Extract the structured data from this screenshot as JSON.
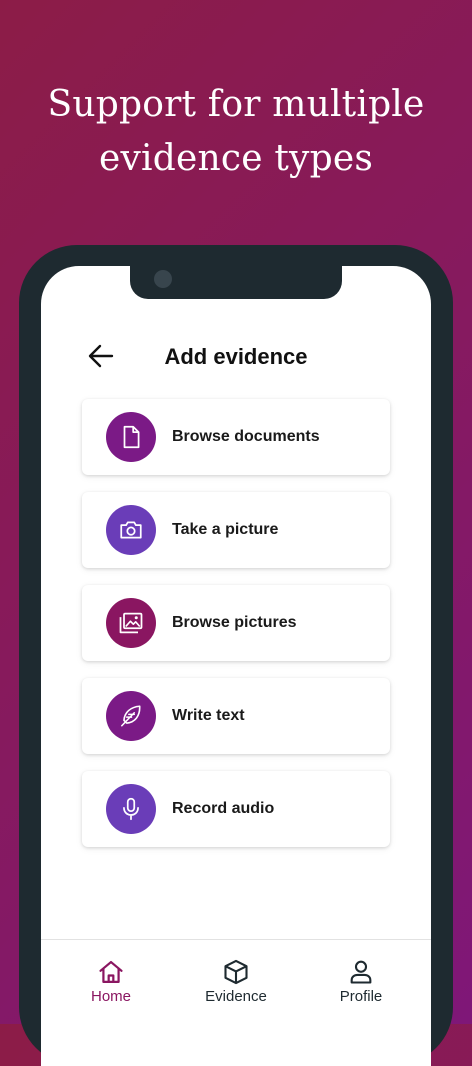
{
  "headline": {
    "line1": "Support for multiple",
    "line2": "evidence types"
  },
  "header": {
    "back_icon": "arrow-left-icon",
    "title": "Add evidence"
  },
  "options": [
    {
      "label": "Browse documents",
      "icon": "document-icon",
      "color": "#7b1a86"
    },
    {
      "label": "Take a picture",
      "icon": "camera-icon",
      "color": "#6a3db8"
    },
    {
      "label": "Browse pictures",
      "icon": "images-icon",
      "color": "#8a1661"
    },
    {
      "label": "Write text",
      "icon": "feather-icon",
      "color": "#7b1a86"
    },
    {
      "label": "Record audio",
      "icon": "microphone-icon",
      "color": "#6a3db8"
    }
  ],
  "tabs": [
    {
      "label": "Home",
      "icon": "home-icon",
      "active": true
    },
    {
      "label": "Evidence",
      "icon": "box-icon",
      "active": false
    },
    {
      "label": "Profile",
      "icon": "user-icon",
      "active": false
    }
  ],
  "colors": {
    "active_tab": "#8a1661",
    "inactive_tab": "#1e2a30",
    "phone_frame": "#1e2a30"
  }
}
